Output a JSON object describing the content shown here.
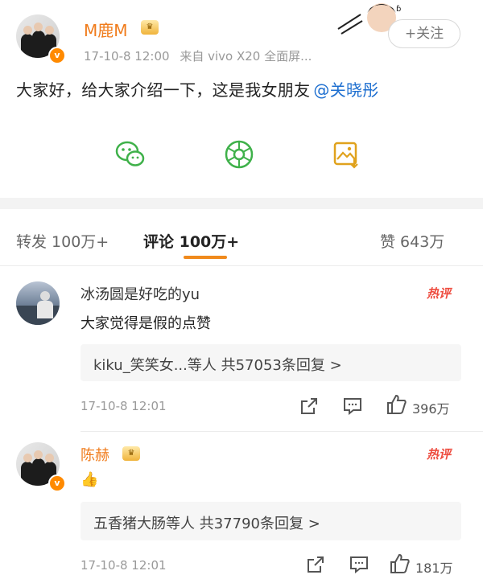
{
  "post": {
    "author": "M鹿M",
    "author_badge_icon": "crown-badge-icon",
    "timestamp": "17-10-8 12:00",
    "source": "来自 vivo X20 全面屏...",
    "follow_label": "+关注",
    "text_prefix": "大家好，给大家介绍一下，这是我女朋友",
    "mention": "@关晓彤",
    "actions": [
      "wechat-share-icon",
      "moments-share-icon",
      "save-image-icon"
    ]
  },
  "tabs": {
    "repost": "转发 100万+",
    "comments": "评论 100万+",
    "likes": "赞 643万",
    "active": "comments"
  },
  "comments": [
    {
      "user": "冰汤圆是好吃的yu",
      "badge": "热评",
      "text": "大家觉得是假的点赞",
      "replies": "kiku_笑笑女...等人 共57053条回复 >",
      "time": "17-10-8 12:01",
      "likes": "396万"
    },
    {
      "user": "陈赫",
      "badge": "热评",
      "text": "👍",
      "replies": "五香猪大肠等人 共37790条回复 >",
      "time": "17-10-8 12:01",
      "likes": "181万"
    }
  ],
  "colors": {
    "accent": "#f08a1c",
    "mention": "#1e6fd0",
    "hot": "#ee4b3e",
    "wechat": "#3fb14a"
  }
}
